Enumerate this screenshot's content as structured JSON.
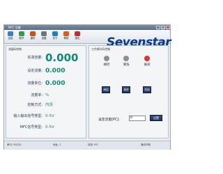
{
  "window": {
    "title": "MFC 设备",
    "min": "_",
    "max": "□",
    "close": "×"
  },
  "toolbar": {
    "items": [
      {
        "label": "连接",
        "color": "#3a7bd5"
      },
      {
        "label": "断开",
        "color": "#2f9e44"
      },
      {
        "label": "通讯",
        "color": "#d9480f"
      },
      {
        "label": "设置",
        "color": "#6c757d"
      },
      {
        "label": "关于",
        "color": "#1c7ed6"
      },
      {
        "label": "帮助",
        "color": "#e8590c"
      },
      {
        "label": "退出",
        "color": "#c92a2a"
      }
    ]
  },
  "brand": "Sevenstar",
  "left_panel": {
    "header": "流量&控制",
    "rows": [
      {
        "label": "实测流量:",
        "value": "0.000",
        "style": "big"
      },
      {
        "label": "设定流量:",
        "value": "0.000",
        "style": "mid"
      },
      {
        "label": "流量单位:",
        "value": "0.000",
        "style": "mid"
      },
      {
        "label": "流量单:",
        "value": "%",
        "style": "sml"
      },
      {
        "label": "控制方式:",
        "value": "内设",
        "style": "sml"
      },
      {
        "label": "输入输出信号类型:",
        "value": "0-5V",
        "style": "sml"
      },
      {
        "label": "MFC信号类型:",
        "value": "0-5V",
        "style": "sml"
      }
    ]
  },
  "right_panel": {
    "header": "工作模式&控制",
    "leds": [
      {
        "label": "阀控",
        "color": "#8a8f96"
      },
      {
        "label": "清洗",
        "color": "#8a8f96"
      },
      {
        "label": "关闭",
        "color": "#e03131"
      }
    ],
    "buttons": [
      {
        "label": "阀控"
      },
      {
        "label": "清洗"
      },
      {
        "label": "关闭"
      }
    ],
    "setpoint_label": "设定流量[PC]:",
    "setpoint_value": "0",
    "setpoint_button": "设置"
  },
  "statusbar": {
    "items": [
      "串口: RS232",
      "地址: 1",
      "状态: IPC",
      "通讯中断"
    ]
  }
}
